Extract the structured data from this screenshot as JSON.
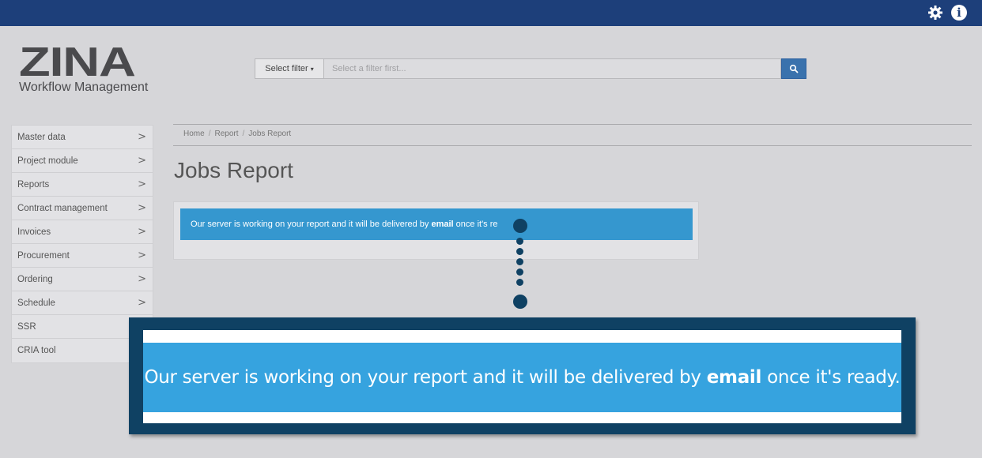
{
  "topbar": {
    "settings_icon": "gear-icon",
    "info_icon": "info-icon",
    "info_glyph": "i",
    "bg_color": "#1d3f7a"
  },
  "logo": {
    "mark": "ZINA",
    "subtitle": "Workflow Management"
  },
  "search": {
    "filter_label": "Select filter",
    "placeholder": "Select a filter first...",
    "button_icon": "search-icon",
    "button_color": "#3a72ad"
  },
  "sidebar": {
    "items": [
      {
        "label": "Master data",
        "has_chevron": true
      },
      {
        "label": "Project module",
        "has_chevron": true
      },
      {
        "label": "Reports",
        "has_chevron": true
      },
      {
        "label": "Contract management",
        "has_chevron": true
      },
      {
        "label": "Invoices",
        "has_chevron": true
      },
      {
        "label": "Procurement",
        "has_chevron": true
      },
      {
        "label": "Ordering",
        "has_chevron": true
      },
      {
        "label": "Schedule",
        "has_chevron": true
      },
      {
        "label": "SSR",
        "has_chevron": false
      },
      {
        "label": "CRIA tool",
        "has_chevron": false
      }
    ],
    "chevron_glyph": ">"
  },
  "breadcrumb": {
    "items": [
      "Home",
      "Report",
      "Jobs Report"
    ],
    "separator": "/"
  },
  "page": {
    "title": "Jobs Report"
  },
  "alert": {
    "text_before": "Our server is working on your report and it will be delivered by ",
    "bold": "email",
    "text_after_visible": " once it's re",
    "color": "#3597cf"
  },
  "callout": {
    "text_before": "Our server is working on your report and it will be delivered by ",
    "bold": "email",
    "text_after": " once it's ready.",
    "frame_color": "#0f4163",
    "message_color": "#36a3df"
  }
}
